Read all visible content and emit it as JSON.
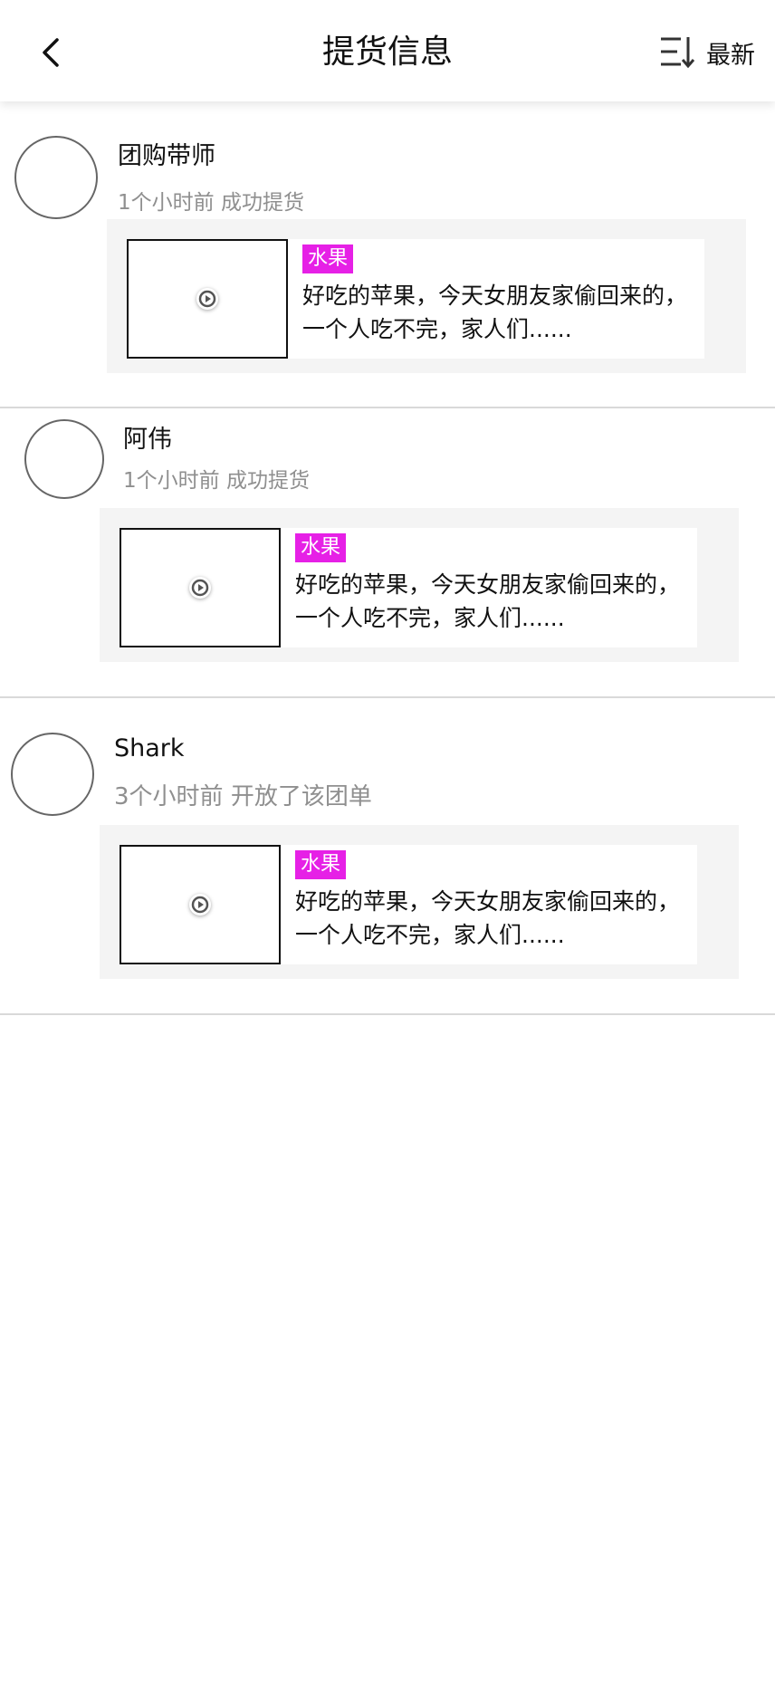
{
  "header": {
    "title": "提货信息",
    "sort_label": "最新",
    "back_icon": "chevron-left-icon",
    "sort_icon": "sort-descending-icon"
  },
  "feed": [
    {
      "user": "团购带师",
      "time": "1个小时前",
      "action": "成功提货",
      "tag": "水果",
      "description": "好吃的苹果，今天女朋友家偷回来的，一个人吃不完，家人们......"
    },
    {
      "user": "阿伟",
      "time": "1个小时前",
      "action": "成功提货",
      "tag": "水果",
      "description": "好吃的苹果，今天女朋友家偷回来的，一个人吃不完，家人们......"
    },
    {
      "user": "Shark",
      "time": "3个小时前",
      "action": "开放了该团单",
      "tag": "水果",
      "description": "好吃的苹果，今天女朋友家偷回来的，一个人吃不完，家人们......"
    }
  ],
  "colors": {
    "tag_bg": "#e620e6",
    "meta_text": "#8f8f8f",
    "card_bg": "#f4f4f4",
    "divider": "#d9d9d9"
  }
}
